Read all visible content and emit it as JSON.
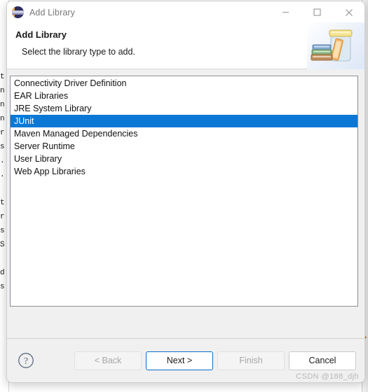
{
  "window": {
    "title": "Add Library",
    "icon": "eclipse-icon",
    "controls": {
      "minimize": "minimize-icon",
      "maximize": "maximize-icon",
      "close": "close-icon"
    }
  },
  "header": {
    "title": "Add Library",
    "description": "Select the library type to add.",
    "banner_icon": "library-jar-books-icon"
  },
  "library_list": {
    "selected_index": 3,
    "items": [
      "Connectivity Driver Definition",
      "EAR Libraries",
      "JRE System Library",
      "JUnit",
      "Maven Managed Dependencies",
      "Server Runtime",
      "User Library",
      "Web App Libraries"
    ]
  },
  "buttons": {
    "help": "?",
    "back": "< Back",
    "next": "Next >",
    "finish": "Finish",
    "cancel": "Cancel"
  },
  "watermark": "CSDN @188_djh",
  "background_editor": {
    "code_sliver": "t\nn\nn\nn\nr\ns\n.\n.\n\nt\nr\ns\nS\n\nd\ns"
  },
  "colors": {
    "selection_blue": "#0a78d4",
    "default_button_border": "#0a6cc4",
    "dialog_bg": "#f0f0f0",
    "list_bg": "#ffffff",
    "title_text": "#7a7a7a",
    "watermark": "#b8b8b8"
  }
}
